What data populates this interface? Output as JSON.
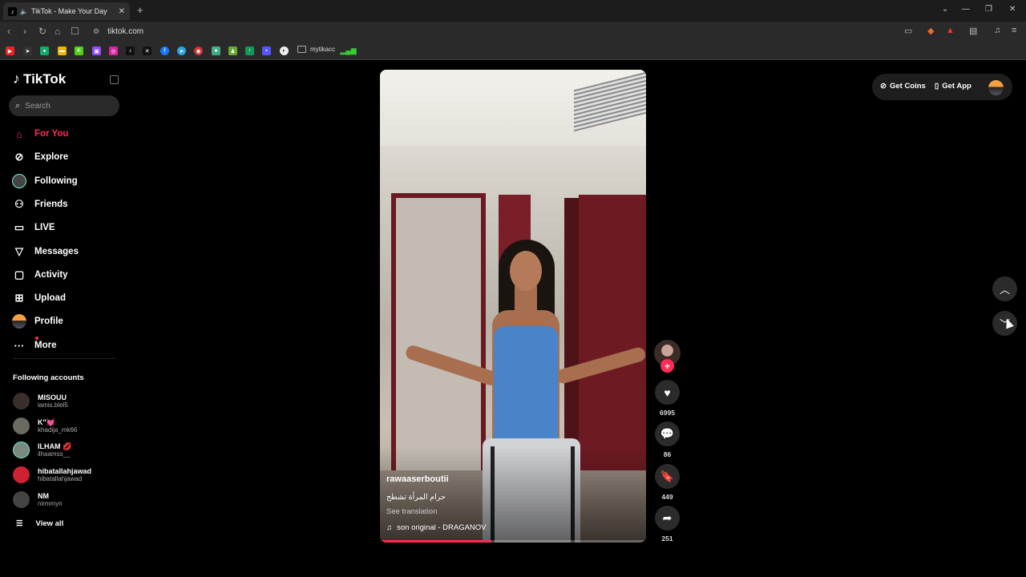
{
  "browser": {
    "tab_title": "TikTok - Make Your Day",
    "url": "tiktok.com",
    "bookmark_folder": "mytikacc"
  },
  "sidebar": {
    "logo": "TikTok",
    "search_placeholder": "Search",
    "nav": [
      {
        "label": "For You",
        "icon": "home-icon",
        "active": true
      },
      {
        "label": "Explore",
        "icon": "compass-icon"
      },
      {
        "label": "Following",
        "icon": "following-avatar"
      },
      {
        "label": "Friends",
        "icon": "friends-icon"
      },
      {
        "label": "LIVE",
        "icon": "live-icon"
      },
      {
        "label": "Messages",
        "icon": "messages-icon"
      },
      {
        "label": "Activity",
        "icon": "activity-icon"
      },
      {
        "label": "Upload",
        "icon": "upload-icon"
      },
      {
        "label": "Profile",
        "icon": "profile-avatar"
      },
      {
        "label": "More",
        "icon": "more-icon"
      }
    ],
    "following_title": "Following accounts",
    "accounts": [
      {
        "name": "MISOUU",
        "handle": "lamis.blel5"
      },
      {
        "name": "K\"💓",
        "handle": "khadija_mk66"
      },
      {
        "name": "ILHAM 💋",
        "handle": "ilhaamss__"
      },
      {
        "name": "hibatallahjawad",
        "handle": "hibatallahjawad"
      },
      {
        "name": "NM",
        "handle": "nirmmyn"
      }
    ],
    "view_all": "View all"
  },
  "video": {
    "username": "rawaaserboutii",
    "caption": "حرام المرأة تشطح",
    "see_translation": "See translation",
    "music": "son original - DRAGANOV",
    "progress": 0.42
  },
  "actions": {
    "likes": "6995",
    "comments": "86",
    "saves": "449",
    "shares": "251"
  },
  "header": {
    "get_coins": "Get Coins",
    "get_app": "Get App"
  },
  "colors": {
    "accent": "#fe2c55"
  }
}
